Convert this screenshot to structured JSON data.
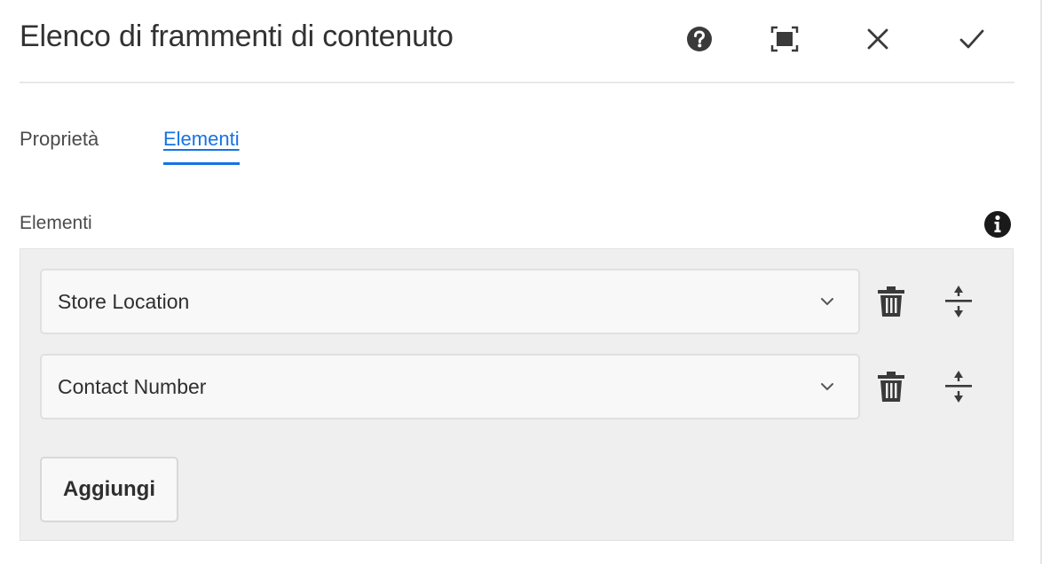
{
  "dialog": {
    "title": "Elenco di frammenti di contenuto",
    "actions": [
      {
        "icon": "help-icon"
      },
      {
        "icon": "fullscreen-icon"
      },
      {
        "icon": "close-icon"
      },
      {
        "icon": "checkmark-icon"
      }
    ]
  },
  "tabs": [
    {
      "label": "Proprietà",
      "active": false
    },
    {
      "label": "Elementi",
      "active": true
    }
  ],
  "elements_section": {
    "label": "Elementi",
    "info_icon": "info-icon",
    "items": [
      {
        "value": "Store Location",
        "delete_icon": "trash-icon",
        "reorder_icon": "reorder-icon"
      },
      {
        "value": "Contact Number",
        "delete_icon": "trash-icon",
        "reorder_icon": "reorder-icon"
      }
    ],
    "add_button_label": "Aggiungi"
  },
  "colors": {
    "accent": "#1473e6",
    "panel_background": "#efefef",
    "text": "#323232"
  }
}
